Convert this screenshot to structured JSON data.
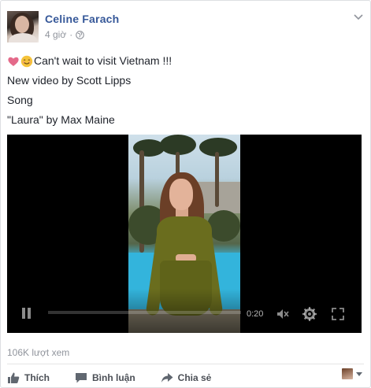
{
  "post": {
    "author": "Celine Farach",
    "time": "4 giờ",
    "separator": "·",
    "audience_icon": "globe-icon",
    "menu_icon": "chevron-down-icon",
    "text_lines": [
      "Can't wait to visit Vietnam !!!",
      "New video by Scott Lipps",
      "Song",
      "\"Laura\" by Max Maine"
    ],
    "emojis": [
      "heart-emoji",
      "smile-emoji"
    ]
  },
  "video": {
    "time": "0:20",
    "progress": 0,
    "icons": [
      "pause-icon",
      "volume-mute-icon",
      "settings-icon",
      "fullscreen-icon"
    ]
  },
  "footer": {
    "views": "106K lượt xem",
    "like_label": "Thích",
    "comment_label": "Bình luận",
    "share_label": "Chia sẻ"
  },
  "colors": {
    "author_link": "#365899",
    "meta_gray": "#90949c",
    "action_gray": "#4b4f56",
    "heart": "#e0245e",
    "smile": "#f5c33b"
  }
}
